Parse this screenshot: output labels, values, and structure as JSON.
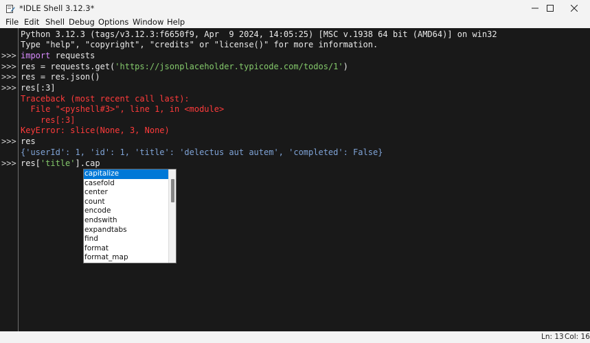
{
  "window": {
    "title": "*IDLE Shell 3.12.3*",
    "controls": {
      "minimize": "minimize",
      "maximize": "maximize",
      "close": "close"
    }
  },
  "menu": [
    "File",
    "Edit",
    "Shell",
    "Debug",
    "Options",
    "Window",
    "Help"
  ],
  "shell": {
    "prompt": ">>>",
    "banner1": "Python 3.12.3 (tags/v3.12.3:f6650f9, Apr  9 2024, 14:05:25) [MSC v.1938 64 bit (AMD64)] on win32",
    "banner2": "Type \"help\", \"copyright\", \"credits\" or \"license()\" for more information.",
    "line3_kw": "import",
    "line3_rest": " requests",
    "line4_a": "res = requests.get(",
    "line4_str": "'https://jsonplaceholder.typicode.com/todos/1'",
    "line4_b": ")",
    "line5": "res = res.json()",
    "line6": "res[:3]",
    "tb1": "Traceback (most recent call last):",
    "tb2": "  File \"<pyshell#3>\", line 1, in <module>",
    "tb3": "    res[:3]",
    "tb4": "KeyError: slice(None, 3, None)",
    "line11": "res",
    "output": "{'userId': 1, 'id': 1, 'title': 'delectus aut autem', 'completed': False}",
    "line13_a": "res[",
    "line13_str": "'title'",
    "line13_b": "].cap"
  },
  "autocomplete": {
    "items": [
      "capitalize",
      "casefold",
      "center",
      "count",
      "encode",
      "endswith",
      "expandtabs",
      "find",
      "format",
      "format_map"
    ],
    "selected": "capitalize",
    "selection_color": "#0078d7"
  },
  "status": {
    "line": "Ln: 13",
    "col": "Col: 16"
  },
  "colors": {
    "background": "#191919",
    "keyword": "#d98cff",
    "string": "#84c96b",
    "error": "#ff3b3b",
    "output": "#7fa3d6"
  }
}
